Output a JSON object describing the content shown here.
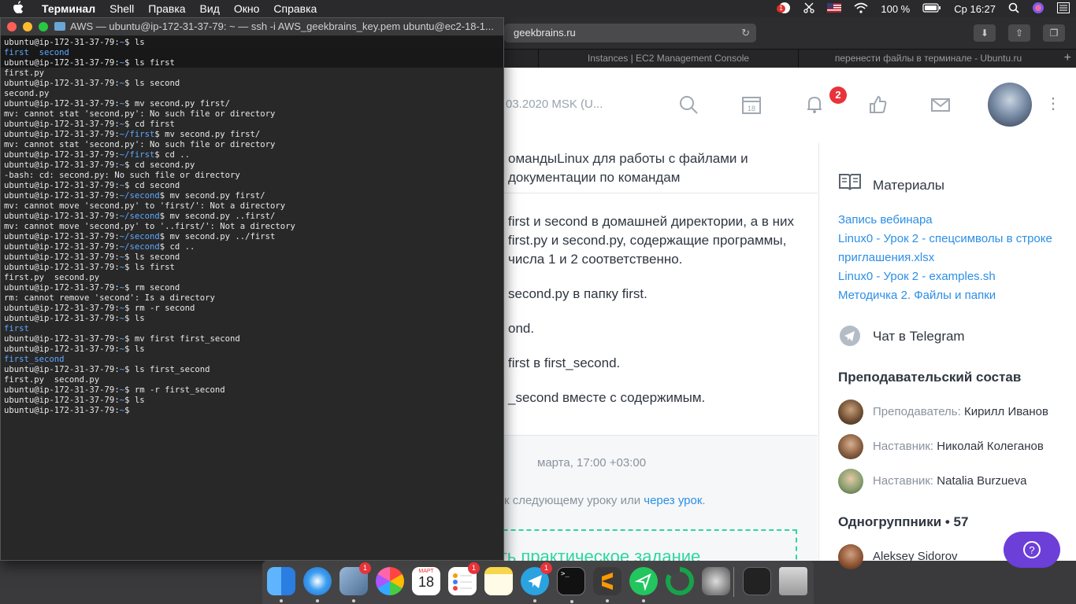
{
  "menubar": {
    "app": "Терминал",
    "items": [
      "Shell",
      "Правка",
      "Вид",
      "Окно",
      "Справка"
    ],
    "battery": "100 %",
    "clock": "Ср 16:27",
    "notif_count": "1"
  },
  "browser": {
    "url": "geekbrains.ru",
    "tabs": [
      "Instances | EC2 Management Console",
      "перенести файлы в терминале - Ubuntu.ru"
    ],
    "header": {
      "date_text": "03.2020 MSK (U...",
      "notif_count": "2"
    },
    "lesson": {
      "title": "омандыLinux для работы с файлами и",
      "title_line2": "документации по командам",
      "tasks": [
        "first и second в домашней директории, а в них",
        "first.py и second.py, содержащие программы,",
        "числа 1 и 2 соответственно.",
        "second.py в папку first.",
        "ond.",
        "first в first_second.",
        "_second вместе с содержимым."
      ],
      "due": "марта, 17:00 +03:00",
      "note_prefix": "к следующему уроку или ",
      "note_link": "через урок",
      "note_suffix": ".",
      "submit_label": "ать практическое задание"
    },
    "sidebar": {
      "materials_title": "Материалы",
      "materials": [
        "Запись вебинара",
        "Linux0 - Урок 2 - спецсимволы в строке приглашения.xlsx",
        "Linux0 - Урок 2 - examples.sh",
        "Методичка 2. Файлы и папки"
      ],
      "telegram_title": "Чат в Telegram",
      "staff_title": "Преподавательский состав",
      "staff": [
        {
          "role": "Преподаватель:",
          "name": "Кирилл Иванов"
        },
        {
          "role": "Наставник:",
          "name": "Николай Колеганов"
        },
        {
          "role": "Наставник:",
          "name": "Natalia Burzueva"
        }
      ],
      "classmates_title": "Одногруппники • 57",
      "classmate": "Aleksey Sidorov",
      "help": "?"
    }
  },
  "terminal": {
    "title": "AWS — ubuntu@ip-172-31-37-79: ~ — ssh -i AWS_geekbrains_key.pem ubuntu@ec2-18-1...",
    "lines": [
      {
        "prompt": "ubuntu@ip-172-31-37-79:",
        "dir": "~",
        "cmd": "$ ls"
      },
      {
        "out": "first  second",
        "outdir": true
      },
      {
        "prompt": "ubuntu@ip-172-31-37-79:",
        "dir": "~",
        "cmd": "$ ls first"
      },
      {
        "out": "first.py"
      },
      {
        "prompt": "ubuntu@ip-172-31-37-79:",
        "dir": "~",
        "cmd": "$ ls second"
      },
      {
        "out": "second.py"
      },
      {
        "prompt": "ubuntu@ip-172-31-37-79:",
        "dir": "~",
        "cmd": "$ mv second.py first/"
      },
      {
        "out": "mv: cannot stat 'second.py': No such file or directory"
      },
      {
        "prompt": "ubuntu@ip-172-31-37-79:",
        "dir": "~",
        "cmd": "$ cd first"
      },
      {
        "prompt": "ubuntu@ip-172-31-37-79:",
        "dir": "~/first",
        "cmd": "$ mv second.py first/"
      },
      {
        "out": "mv: cannot stat 'second.py': No such file or directory"
      },
      {
        "prompt": "ubuntu@ip-172-31-37-79:",
        "dir": "~/first",
        "cmd": "$ cd .."
      },
      {
        "prompt": "ubuntu@ip-172-31-37-79:",
        "dir": "~",
        "cmd": "$ cd second.py"
      },
      {
        "out": "-bash: cd: second.py: No such file or directory"
      },
      {
        "prompt": "ubuntu@ip-172-31-37-79:",
        "dir": "~",
        "cmd": "$ cd second"
      },
      {
        "prompt": "ubuntu@ip-172-31-37-79:",
        "dir": "~/second",
        "cmd": "$ mv second.py first/"
      },
      {
        "out": "mv: cannot move 'second.py' to 'first/': Not a directory"
      },
      {
        "prompt": "ubuntu@ip-172-31-37-79:",
        "dir": "~/second",
        "cmd": "$ mv second.py ..first/"
      },
      {
        "out": "mv: cannot move 'second.py' to '..first/': Not a directory"
      },
      {
        "prompt": "ubuntu@ip-172-31-37-79:",
        "dir": "~/second",
        "cmd": "$ mv second.py ../first"
      },
      {
        "prompt": "ubuntu@ip-172-31-37-79:",
        "dir": "~/second",
        "cmd": "$ cd .."
      },
      {
        "prompt": "ubuntu@ip-172-31-37-79:",
        "dir": "~",
        "cmd": "$ ls second"
      },
      {
        "prompt": "ubuntu@ip-172-31-37-79:",
        "dir": "~",
        "cmd": "$ ls first"
      },
      {
        "out": "first.py  second.py"
      },
      {
        "prompt": "ubuntu@ip-172-31-37-79:",
        "dir": "~",
        "cmd": "$ rm second"
      },
      {
        "out": "rm: cannot remove 'second': Is a directory"
      },
      {
        "prompt": "ubuntu@ip-172-31-37-79:",
        "dir": "~",
        "cmd": "$ rm -r second"
      },
      {
        "prompt": "ubuntu@ip-172-31-37-79:",
        "dir": "~",
        "cmd": "$ ls"
      },
      {
        "out": "first",
        "outdir": true
      },
      {
        "prompt": "ubuntu@ip-172-31-37-79:",
        "dir": "~",
        "cmd": "$ mv first first_second"
      },
      {
        "prompt": "ubuntu@ip-172-31-37-79:",
        "dir": "~",
        "cmd": "$ ls"
      },
      {
        "out": "first_second",
        "outdir": true
      },
      {
        "prompt": "ubuntu@ip-172-31-37-79:",
        "dir": "~",
        "cmd": "$ ls first_second"
      },
      {
        "out": "first.py  second.py"
      },
      {
        "prompt": "ubuntu@ip-172-31-37-79:",
        "dir": "~",
        "cmd": "$ rm -r first_second"
      },
      {
        "prompt": "ubuntu@ip-172-31-37-79:",
        "dir": "~",
        "cmd": "$ ls"
      },
      {
        "prompt": "ubuntu@ip-172-31-37-79:",
        "dir": "~",
        "cmd": "$ "
      }
    ]
  },
  "dock": {
    "apps": [
      {
        "name": "finder",
        "color": "#3a8ee6"
      },
      {
        "name": "safari",
        "color": "#2a7de1"
      },
      {
        "name": "mail-plane",
        "color": "#6b8fb5",
        "badge": "1"
      },
      {
        "name": "photos",
        "color": "#f0a030"
      },
      {
        "name": "calendar",
        "color": "#ffffff",
        "label": "18"
      },
      {
        "name": "reminders",
        "color": "#ffffff",
        "badge": "1"
      },
      {
        "name": "notes",
        "color": "#f7d64a"
      },
      {
        "name": "telegram",
        "color": "#2aa3e0",
        "badge": "1"
      },
      {
        "name": "terminal",
        "color": "#111111"
      },
      {
        "name": "sublime-text",
        "color": "#ff9800"
      },
      {
        "name": "send-arrow",
        "color": "#22c55e"
      },
      {
        "name": "circle-app",
        "color": "#16a34a"
      },
      {
        "name": "system-preferences",
        "color": "#8a8a8a"
      }
    ],
    "calendar_month": "МАРТ",
    "calendar_day": "18"
  }
}
